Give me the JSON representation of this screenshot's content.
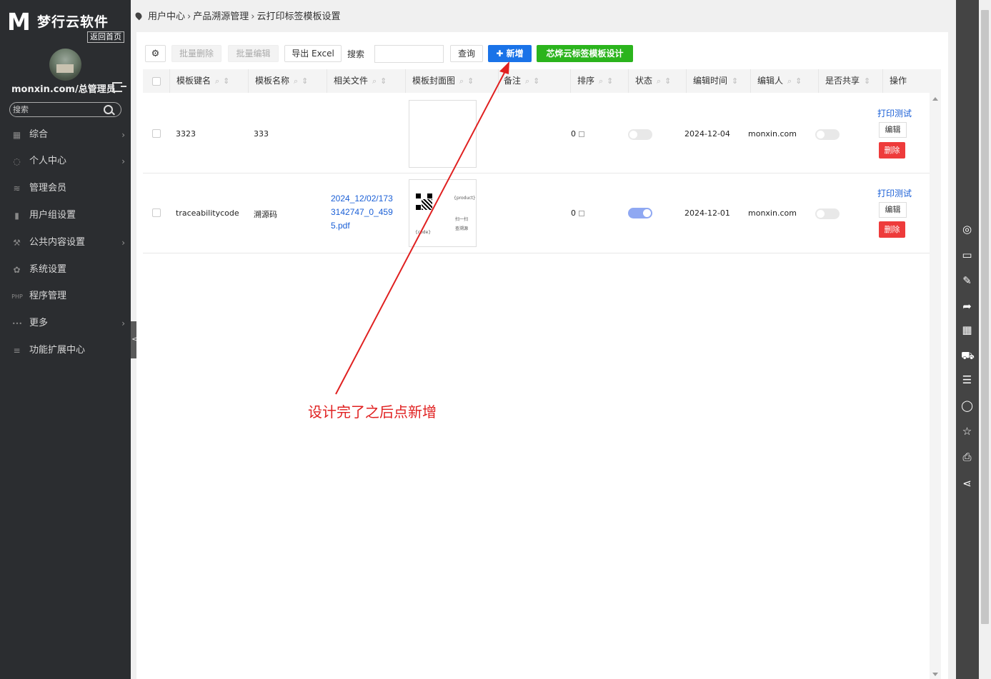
{
  "sidebar": {
    "logo_mark": "M",
    "brand": "梦行云软件",
    "home_link": "返回首页",
    "user": "monxin.com/总管理员",
    "search_placeholder": "搜索",
    "collapse_label": "<",
    "menu": [
      {
        "label": "综合",
        "icon": "grid-icon",
        "glyph": "▦",
        "arrow": true
      },
      {
        "label": "个人中心",
        "icon": "person-icon",
        "glyph": "◌",
        "arrow": true
      },
      {
        "label": "管理会员",
        "icon": "layers-icon",
        "glyph": "≋",
        "arrow": false
      },
      {
        "label": "用户组设置",
        "icon": "bar-chart-icon",
        "glyph": "▮",
        "arrow": false
      },
      {
        "label": "公共内容设置",
        "icon": "tools-icon",
        "glyph": "⚒",
        "arrow": true
      },
      {
        "label": "系统设置",
        "icon": "gear-icon",
        "glyph": "✿",
        "arrow": false
      },
      {
        "label": "程序管理",
        "icon": "php-icon",
        "glyph": "PHP",
        "arrow": false
      },
      {
        "label": "更多",
        "icon": "more-icon",
        "glyph": "•••",
        "arrow": true
      },
      {
        "label": "功能扩展中心",
        "icon": "menu-lines-icon",
        "glyph": "≡",
        "arrow": false
      }
    ]
  },
  "breadcrumb": [
    "用户中心",
    "产品溯源管理",
    "云打印标签模板设置"
  ],
  "toolbar": {
    "batch_delete": "批量删除",
    "batch_edit": "批量编辑",
    "export_excel": "导出 Excel",
    "search_label": "搜索",
    "search_value": "",
    "query": "查询",
    "add": "✚ 新增",
    "design": "芯烨云标签模板设计"
  },
  "table": {
    "columns": [
      "模板键名",
      "模板名称",
      "相关文件",
      "模板封面图",
      "备注",
      "排序",
      "状态",
      "编辑时间",
      "编辑人",
      "是否共享",
      "操作"
    ],
    "rows": [
      {
        "key": "3323",
        "name": "333",
        "file": "",
        "note": "",
        "sort": "0",
        "status_on": false,
        "time": "2024-12-04",
        "editor": "monxin.com",
        "shared": false,
        "print_test": "打印测试",
        "edit": "编辑",
        "delete": "删除"
      },
      {
        "key": "traceabilitycode",
        "name": "溯源码",
        "file": "2024_12/02/1733142747_0_4595.pdf",
        "file_lines": [
          "2024_12/02/173",
          "3142747_0_459",
          "5.pdf"
        ],
        "note": "",
        "sort": "0",
        "status_on": true,
        "time": "2024-12-01",
        "editor": "monxin.com",
        "shared": false,
        "print_test": "打印测试",
        "edit": "编辑",
        "delete": "删除",
        "cover_text": {
          "product": "{product}",
          "scan": "扫一扫",
          "query": "查溯源",
          "code": "{code}"
        }
      }
    ]
  },
  "right_bar_icons": [
    "wechat-icon",
    "comment-icon",
    "edit-icon",
    "share-forward-icon",
    "qrcode-icon",
    "cart-icon",
    "list-icon",
    "user-icon",
    "star-icon",
    "print-icon",
    "share-icon"
  ],
  "annotation": "设计完了之后点新增",
  "colors": {
    "sidebar_bg": "#2b2d30",
    "primary": "#1a73e8",
    "success": "#2bb41d",
    "danger": "#ee3b3b",
    "annotation": "#e02020"
  }
}
